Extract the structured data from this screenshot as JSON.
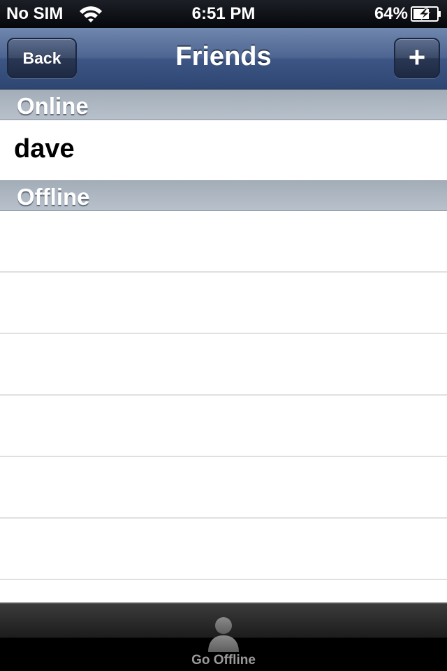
{
  "status_bar": {
    "carrier": "No SIM",
    "time": "6:51 PM",
    "battery_percent": "64%",
    "wifi_icon": "wifi-icon",
    "battery_icon": "battery-charging-icon"
  },
  "nav": {
    "title": "Friends",
    "back_label": "Back",
    "add_label": "+"
  },
  "sections": {
    "online": {
      "header": "Online",
      "friends": [
        "dave"
      ]
    },
    "offline": {
      "header": "Offline",
      "friends": []
    }
  },
  "tab_bar": {
    "items": [
      {
        "label": "Go Offline",
        "icon": "person-icon"
      }
    ]
  },
  "colors": {
    "nav_bar": "#4d6591",
    "section_header": "#b8c1cb",
    "tab_label": "#9a9a9a"
  }
}
